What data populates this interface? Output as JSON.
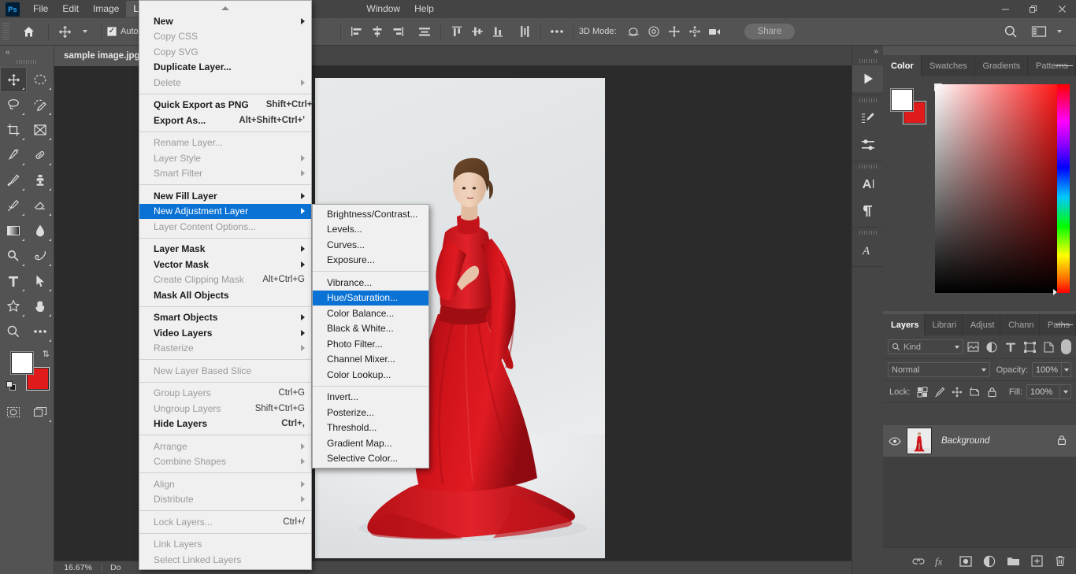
{
  "app": {
    "logo": "Ps",
    "menus": [
      {
        "label": "File",
        "active": false
      },
      {
        "label": "Edit",
        "active": false
      },
      {
        "label": "Image",
        "active": false
      },
      {
        "label": "Layer",
        "active": true
      },
      {
        "label": "Window",
        "active": false
      },
      {
        "label": "Help",
        "active": false
      }
    ],
    "window_controls": {
      "minimize": "–",
      "restore": "❐",
      "close": "✕"
    }
  },
  "options_bar": {
    "home_icon": "home-icon",
    "tool_icon": "move-tool-icon",
    "auto_select_checked": true,
    "auto_select_label": "Auto-Select",
    "three_d_mode_label": "3D Mode:",
    "share_label": "Share",
    "search_icon": "search-icon",
    "workspace_icon": "workspace-icon"
  },
  "toolbar": {
    "collapse_icon": "chevron-double-left-icon",
    "tools": [
      {
        "name": "move-tool",
        "selected": true
      },
      {
        "name": "elliptical-marquee-tool",
        "selected": false
      },
      {
        "name": "lasso-tool",
        "selected": false
      },
      {
        "name": "quick-selection-tool",
        "selected": false
      },
      {
        "name": "crop-tool",
        "selected": false
      },
      {
        "name": "frame-tool",
        "selected": false
      },
      {
        "name": "eyedropper-tool",
        "selected": false
      },
      {
        "name": "healing-brush-tool",
        "selected": false
      },
      {
        "name": "brush-tool",
        "selected": false
      },
      {
        "name": "clone-stamp-tool",
        "selected": false
      },
      {
        "name": "history-brush-tool",
        "selected": false
      },
      {
        "name": "eraser-tool",
        "selected": false
      },
      {
        "name": "gradient-tool",
        "selected": false
      },
      {
        "name": "blur-tool",
        "selected": false
      },
      {
        "name": "dodge-tool",
        "selected": false
      },
      {
        "name": "pen-tool",
        "selected": false
      },
      {
        "name": "type-tool",
        "selected": false
      },
      {
        "name": "path-selection-tool",
        "selected": false
      },
      {
        "name": "custom-shape-tool",
        "selected": false
      },
      {
        "name": "hand-tool",
        "selected": false
      },
      {
        "name": "zoom-tool",
        "selected": false
      },
      {
        "name": "edit-toolbar-tool",
        "selected": false
      }
    ],
    "foreground_color": "#ffffff",
    "background_color": "#e01b1b",
    "quick-mask-icon": "quick-mask-icon",
    "screen-mode-icon": "screen-mode-icon"
  },
  "document": {
    "tab_title": "sample image.jpg",
    "zoom": "16.67%",
    "status_text": "Do"
  },
  "layer_menu": {
    "title": "Layer",
    "items": [
      {
        "label": "New",
        "shortcut": "",
        "submenu": true,
        "disabled": false,
        "bold": true
      },
      {
        "label": "Copy CSS",
        "shortcut": "",
        "submenu": false,
        "disabled": true,
        "bold": false
      },
      {
        "label": "Copy SVG",
        "shortcut": "",
        "submenu": false,
        "disabled": true,
        "bold": false
      },
      {
        "label": "Duplicate Layer...",
        "shortcut": "",
        "submenu": false,
        "disabled": false,
        "bold": true
      },
      {
        "label": "Delete",
        "shortcut": "",
        "submenu": true,
        "disabled": true,
        "bold": false
      },
      {
        "separator": true
      },
      {
        "label": "Quick Export as PNG",
        "shortcut": "Shift+Ctrl+'",
        "submenu": false,
        "disabled": false,
        "bold": true
      },
      {
        "label": "Export As...",
        "shortcut": "Alt+Shift+Ctrl+'",
        "submenu": false,
        "disabled": false,
        "bold": true
      },
      {
        "separator": true
      },
      {
        "label": "Rename Layer...",
        "shortcut": "",
        "submenu": false,
        "disabled": true,
        "bold": false
      },
      {
        "label": "Layer Style",
        "shortcut": "",
        "submenu": true,
        "disabled": true,
        "bold": false
      },
      {
        "label": "Smart Filter",
        "shortcut": "",
        "submenu": true,
        "disabled": true,
        "bold": false
      },
      {
        "separator": true
      },
      {
        "label": "New Fill Layer",
        "shortcut": "",
        "submenu": true,
        "disabled": false,
        "bold": true
      },
      {
        "label": "New Adjustment Layer",
        "shortcut": "",
        "submenu": true,
        "disabled": false,
        "bold": false,
        "highlighted": true
      },
      {
        "label": "Layer Content Options...",
        "shortcut": "",
        "submenu": false,
        "disabled": true,
        "bold": false
      },
      {
        "separator": true
      },
      {
        "label": "Layer Mask",
        "shortcut": "",
        "submenu": true,
        "disabled": false,
        "bold": true
      },
      {
        "label": "Vector Mask",
        "shortcut": "",
        "submenu": true,
        "disabled": false,
        "bold": true
      },
      {
        "label": "Create Clipping Mask",
        "shortcut": "Alt+Ctrl+G",
        "submenu": false,
        "disabled": true,
        "bold": false
      },
      {
        "label": "Mask All Objects",
        "shortcut": "",
        "submenu": false,
        "disabled": false,
        "bold": true
      },
      {
        "separator": true
      },
      {
        "label": "Smart Objects",
        "shortcut": "",
        "submenu": true,
        "disabled": false,
        "bold": true
      },
      {
        "label": "Video Layers",
        "shortcut": "",
        "submenu": true,
        "disabled": false,
        "bold": true
      },
      {
        "label": "Rasterize",
        "shortcut": "",
        "submenu": true,
        "disabled": true,
        "bold": false
      },
      {
        "separator": true
      },
      {
        "label": "New Layer Based Slice",
        "shortcut": "",
        "submenu": false,
        "disabled": true,
        "bold": false
      },
      {
        "separator": true
      },
      {
        "label": "Group Layers",
        "shortcut": "Ctrl+G",
        "submenu": false,
        "disabled": true,
        "bold": false
      },
      {
        "label": "Ungroup Layers",
        "shortcut": "Shift+Ctrl+G",
        "submenu": false,
        "disabled": true,
        "bold": false
      },
      {
        "label": "Hide Layers",
        "shortcut": "Ctrl+,",
        "submenu": false,
        "disabled": false,
        "bold": true
      },
      {
        "separator": true
      },
      {
        "label": "Arrange",
        "shortcut": "",
        "submenu": true,
        "disabled": true,
        "bold": false
      },
      {
        "label": "Combine Shapes",
        "shortcut": "",
        "submenu": true,
        "disabled": true,
        "bold": false
      },
      {
        "separator": true
      },
      {
        "label": "Align",
        "shortcut": "",
        "submenu": true,
        "disabled": true,
        "bold": false
      },
      {
        "label": "Distribute",
        "shortcut": "",
        "submenu": true,
        "disabled": true,
        "bold": false
      },
      {
        "separator": true
      },
      {
        "label": "Lock Layers...",
        "shortcut": "Ctrl+/",
        "submenu": false,
        "disabled": true,
        "bold": false
      },
      {
        "separator": true
      },
      {
        "label": "Link Layers",
        "shortcut": "",
        "submenu": false,
        "disabled": true,
        "bold": false
      },
      {
        "label": "Select Linked Layers",
        "shortcut": "",
        "submenu": false,
        "disabled": true,
        "bold": false
      }
    ]
  },
  "adjustment_submenu": {
    "title": "New Adjustment Layer",
    "items": [
      {
        "label": "Brightness/Contrast...",
        "disabled": false
      },
      {
        "label": "Levels...",
        "disabled": false
      },
      {
        "label": "Curves...",
        "disabled": false
      },
      {
        "label": "Exposure...",
        "disabled": false
      },
      {
        "separator": true
      },
      {
        "label": "Vibrance...",
        "disabled": false
      },
      {
        "label": "Hue/Saturation...",
        "disabled": false,
        "highlighted": true
      },
      {
        "label": "Color Balance...",
        "disabled": false
      },
      {
        "label": "Black & White...",
        "disabled": false
      },
      {
        "label": "Photo Filter...",
        "disabled": false
      },
      {
        "label": "Channel Mixer...",
        "disabled": false
      },
      {
        "label": "Color Lookup...",
        "disabled": false
      },
      {
        "separator": true
      },
      {
        "label": "Invert...",
        "disabled": false
      },
      {
        "label": "Posterize...",
        "disabled": false
      },
      {
        "label": "Threshold...",
        "disabled": false
      },
      {
        "label": "Gradient Map...",
        "disabled": false
      },
      {
        "label": "Selective Color...",
        "disabled": false
      }
    ]
  },
  "icon_rail": {
    "collapse_icon": "chevron-double-right-icon",
    "buttons": [
      {
        "name": "play-actions-icon"
      },
      {
        "name": "brush-settings-icon"
      },
      {
        "name": "adjustments-icon"
      },
      {
        "name": "character-panel-icon"
      },
      {
        "name": "paragraph-panel-icon"
      },
      {
        "name": "glyphs-panel-icon"
      }
    ]
  },
  "color_panel": {
    "tabs": [
      {
        "label": "Color",
        "active": true
      },
      {
        "label": "Swatches",
        "active": false
      },
      {
        "label": "Gradients",
        "active": false
      },
      {
        "label": "Patterns",
        "active": false
      }
    ],
    "menu_icon": "panel-menu-icon",
    "foreground_color": "#ffffff",
    "background_color": "#e01b1b",
    "picker_icon": "color-field-marker"
  },
  "layers_panel": {
    "tabs": [
      {
        "label": "Layers",
        "active": true
      },
      {
        "label": "Librari",
        "active": false
      },
      {
        "label": "Adjust",
        "active": false
      },
      {
        "label": "Chann",
        "active": false
      },
      {
        "label": "Paths",
        "active": false
      }
    ],
    "menu_icon": "panel-menu-icon",
    "filter": {
      "kind_label": "Kind",
      "search_icon": "search-icon",
      "icons": [
        "pixel-filter-icon",
        "adjustment-filter-icon",
        "type-filter-icon",
        "shape-filter-icon",
        "smart-object-filter-icon"
      ],
      "toggle_on": true
    },
    "blend_mode": "Normal",
    "opacity_label": "Opacity:",
    "opacity_value": "100%",
    "lock_label": "Lock:",
    "lock_icons": [
      "lock-transparent-pixels-icon",
      "lock-image-pixels-icon",
      "lock-position-icon",
      "lock-artboard-nesting-icon",
      "lock-all-icon"
    ],
    "fill_label": "Fill:",
    "fill_value": "100%",
    "layers": [
      {
        "name": "Background",
        "visible": true,
        "locked": true,
        "italic": true
      }
    ],
    "footer_buttons": [
      {
        "name": "link-layers-icon",
        "glyph": "⚭"
      },
      {
        "name": "layer-style-fx-icon",
        "glyph": "fx"
      },
      {
        "name": "add-layer-mask-icon",
        "glyph": ""
      },
      {
        "name": "new-adjustment-layer-icon",
        "glyph": ""
      },
      {
        "name": "new-group-icon",
        "glyph": ""
      },
      {
        "name": "new-layer-icon",
        "glyph": "+"
      },
      {
        "name": "delete-layer-icon",
        "glyph": ""
      }
    ]
  }
}
